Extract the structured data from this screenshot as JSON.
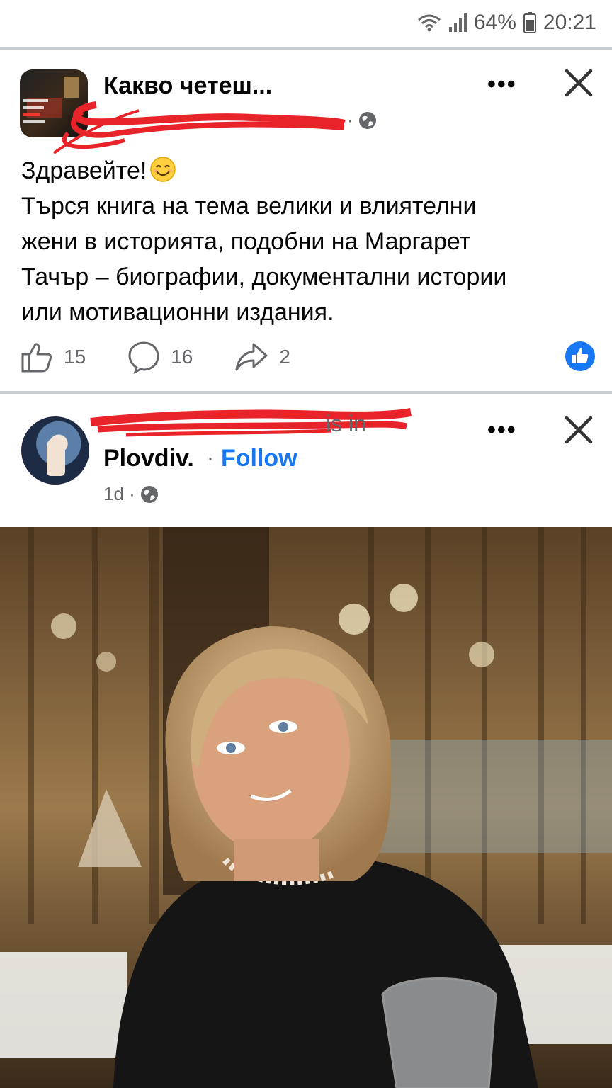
{
  "status_bar": {
    "battery": "64%",
    "time": "20:21"
  },
  "post1": {
    "group_name": "Какво четеш...",
    "text_lines": [
      "Здравейте!",
      "Търся книга на тема велики и влиятелни",
      "жени в историята, подобни на Маргарет",
      "Тачър – биографии, документални истории",
      "или мотивационни издания."
    ],
    "likes": "15",
    "comments": "16",
    "shares": "2"
  },
  "post2": {
    "is_in_text": "is in",
    "place": "Plovdiv.",
    "follow_label": "Follow",
    "time": "1d ·"
  },
  "icons": [
    "wifi-icon",
    "signal-icon",
    "battery-icon",
    "globe-icon",
    "more-icon",
    "close-icon",
    "like-icon",
    "comment-icon",
    "share-icon",
    "reaction-like-icon",
    "smile-emoji-icon"
  ],
  "colors": {
    "accent": "#1877f2",
    "redaction": "#e8232a",
    "separator": "#c9ccd1"
  }
}
